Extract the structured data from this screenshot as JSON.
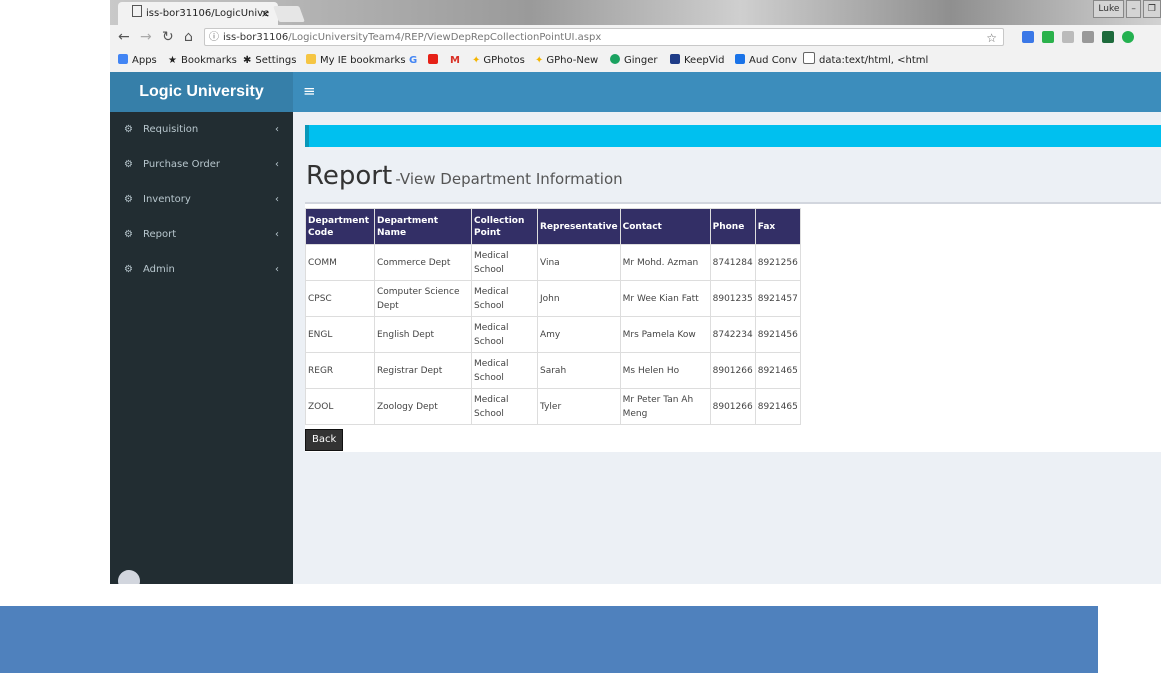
{
  "browser": {
    "tab_title": "iss-bor31106/LogicUnive",
    "tab_close": "×",
    "window_buttons": [
      "Luke",
      "–",
      "❐"
    ],
    "url_host": "iss-bor31106",
    "url_path": "/LogicUniversityTeam4/REP/ViewDepRepCollectionPointUI.aspx",
    "bookmarks": [
      "Apps",
      "Bookmarks",
      "Settings",
      "My IE bookmarks",
      "G",
      "",
      "M",
      "GPhotos",
      "GPho-New",
      "Ginger",
      "KeepVid",
      "Aud Conv",
      "data:text/html, <html"
    ]
  },
  "app": {
    "brand": "Logic University",
    "sidebar": [
      {
        "label": "Requisition"
      },
      {
        "label": "Purchase Order"
      },
      {
        "label": "Inventory"
      },
      {
        "label": "Report"
      },
      {
        "label": "Admin"
      }
    ],
    "page_title": "Report",
    "page_subtitle": "-View Department Information",
    "table": {
      "headers": [
        "Department Code",
        "Department Name",
        "Collection Point",
        "Representative",
        "Contact",
        "Phone",
        "Fax"
      ],
      "rows": [
        [
          "COMM",
          "Commerce Dept",
          "Medical School",
          "Vina",
          "Mr Mohd. Azman",
          "8741284",
          "8921256"
        ],
        [
          "CPSC",
          "Computer Science Dept",
          "Medical School",
          "John",
          "Mr Wee Kian Fatt",
          "8901235",
          "8921457"
        ],
        [
          "ENGL",
          "English Dept",
          "Medical School",
          "Amy",
          "Mrs Pamela Kow",
          "8742234",
          "8921456"
        ],
        [
          "REGR",
          "Registrar Dept",
          "Medical School",
          "Sarah",
          "Ms Helen Ho",
          "8901266",
          "8921465"
        ],
        [
          "ZOOL",
          "Zoology Dept",
          "Medical School",
          "Tyler",
          "Mr Peter Tan Ah Meng",
          "8901266",
          "8921465"
        ]
      ]
    },
    "back_label": "Back"
  },
  "colors": {
    "topbar": "#3c8dbc",
    "sidebar": "#222d32",
    "table_header": "#332f66",
    "info_bar": "#00c0ef",
    "bottom_bar": "#4f81bd"
  }
}
